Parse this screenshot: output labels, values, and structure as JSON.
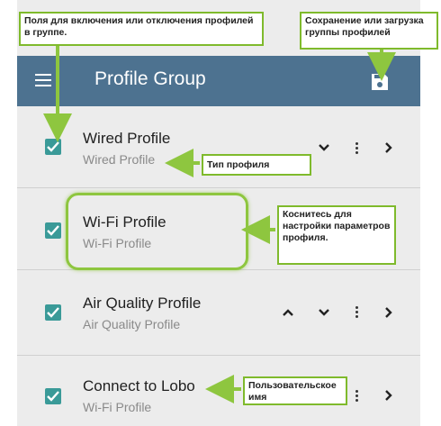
{
  "app": {
    "title": "Profile Group",
    "icons": {
      "menu": "hamburger-menu-icon",
      "save": "save-load-icon"
    },
    "accent_color": "#4d7290",
    "checkbox_color": "#3a9a98",
    "callout_border_color": "#7fba2c"
  },
  "profiles": [
    {
      "title": "Wired Profile",
      "subtitle": "Wired Profile",
      "checked": true,
      "controls": [
        "chevron-down",
        "more-vert",
        "chevron-right"
      ]
    },
    {
      "title": "Wi-Fi Profile",
      "subtitle": "Wi-Fi Profile",
      "checked": true,
      "controls": []
    },
    {
      "title": "Air Quality Profile",
      "subtitle": "Air Quality Profile",
      "checked": true,
      "controls": [
        "chevron-up",
        "chevron-down",
        "more-vert",
        "chevron-right"
      ]
    },
    {
      "title": "Connect to Lobo",
      "subtitle": "Wi-Fi Profile",
      "checked": true,
      "controls": [
        "more-vert",
        "chevron-right"
      ]
    }
  ],
  "callouts": {
    "checkboxes": "Поля для включения или отключения профилей в группе.",
    "save": "Сохранение или загрузка группы профилей",
    "profile_type": "Тип профиля",
    "touch": "Коснитесь для настройки параметров профиля.",
    "custom_name": "Пользовательское имя"
  }
}
